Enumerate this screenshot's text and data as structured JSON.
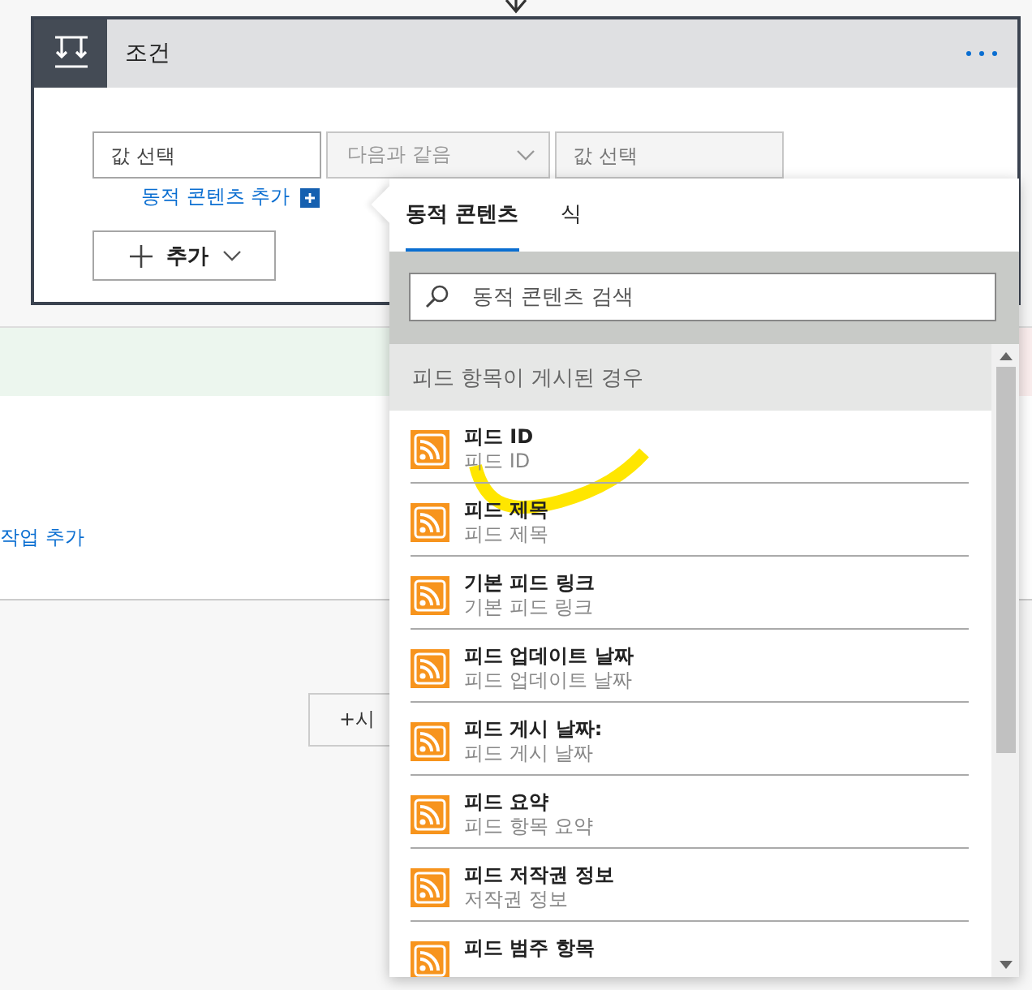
{
  "card": {
    "title": "조건"
  },
  "condition": {
    "left": {
      "placeholder": "값 선택",
      "disabled": false
    },
    "operator": {
      "value": "다음과 같음",
      "disabled": true
    },
    "right": {
      "placeholder": "값 선택",
      "disabled": true
    }
  },
  "add_dynamic_link": "동적 콘텐츠 추가",
  "add_button": "추가",
  "background": {
    "action_link": "작업 추가",
    "step_button": "+시"
  },
  "popup": {
    "tabs": [
      {
        "label": "동적 콘텐츠",
        "selected": true
      },
      {
        "label": "식",
        "selected": false
      }
    ],
    "search": {
      "placeholder": "동적 콘텐츠 검색"
    },
    "section": "피드 항목이 게시된 경우",
    "items": [
      {
        "title": "피드 ID",
        "subtitle": "피드 ID"
      },
      {
        "title": "피드 제목",
        "subtitle": "피드 제목"
      },
      {
        "title": "기본 피드 링크",
        "subtitle": "기본 피드 링크"
      },
      {
        "title": "피드 업데이트 날짜",
        "subtitle": "피드 업데이트 날짜"
      },
      {
        "title": "피드 게시 날짜:",
        "subtitle": "피드 게시 날짜"
      },
      {
        "title": "피드 요약",
        "subtitle": "피드 항목 요약"
      },
      {
        "title": "피드 저작권 정보",
        "subtitle": "저작권 정보"
      },
      {
        "title": "피드 범주 항목"
      }
    ]
  }
}
